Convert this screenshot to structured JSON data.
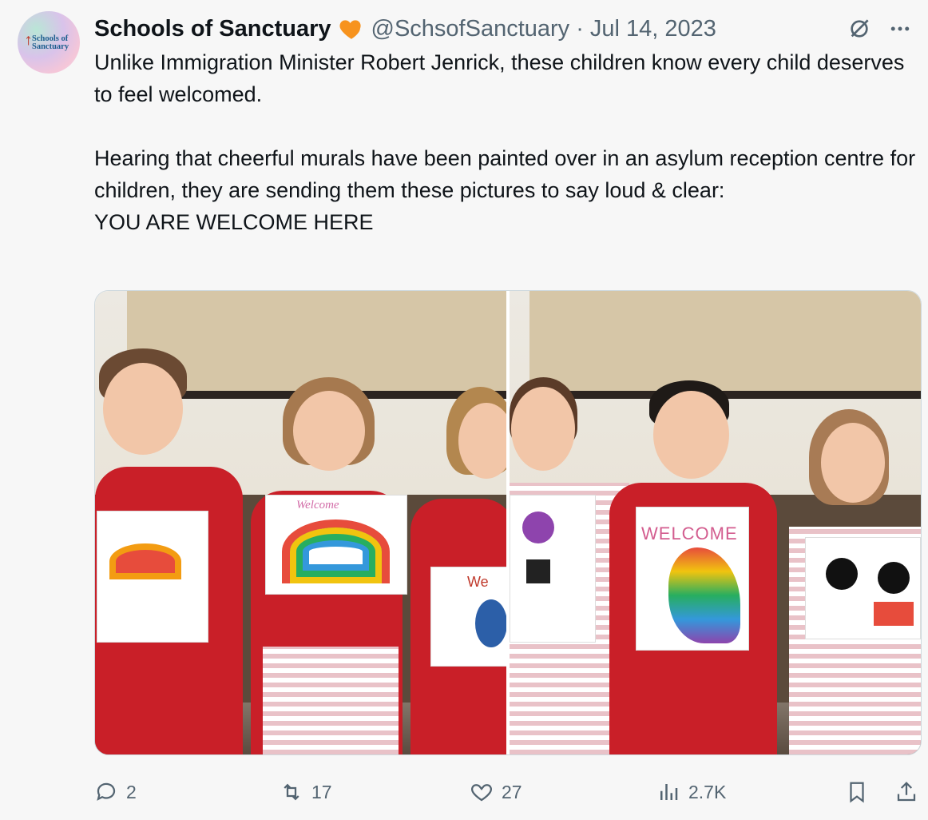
{
  "author": {
    "name": "Schools of Sanctuary",
    "handle": "@SchsofSanctuary",
    "separator": "·",
    "date": "Jul 14, 2023",
    "avatar_text": "Schools of Sanctuary",
    "verified_badge_color": "#f7931e"
  },
  "tweet": {
    "paragraph1": "Unlike Immigration Minister Robert Jenrick, these children know every child deserves to feel welcomed.",
    "paragraph2": "Hearing that cheerful murals have been painted over in an asylum reception centre for children, they are sending them these pictures to say loud & clear:",
    "paragraph3": "YOU ARE WELCOME HERE"
  },
  "media": {
    "photo1_drawing_label": "Welcome",
    "photo1_side_label": "We",
    "photo2_drawing_label": "WELCOME"
  },
  "actions": {
    "replies": "2",
    "reposts": "17",
    "likes": "27",
    "views": "2.7K"
  },
  "icons": [
    "verified-badge-icon",
    "grok-icon",
    "more-icon",
    "reply-icon",
    "repost-icon",
    "like-icon",
    "views-icon",
    "bookmark-icon",
    "share-icon"
  ],
  "colors": {
    "text": "#0f1419",
    "secondary": "#536471",
    "background": "#f7f7f7"
  }
}
